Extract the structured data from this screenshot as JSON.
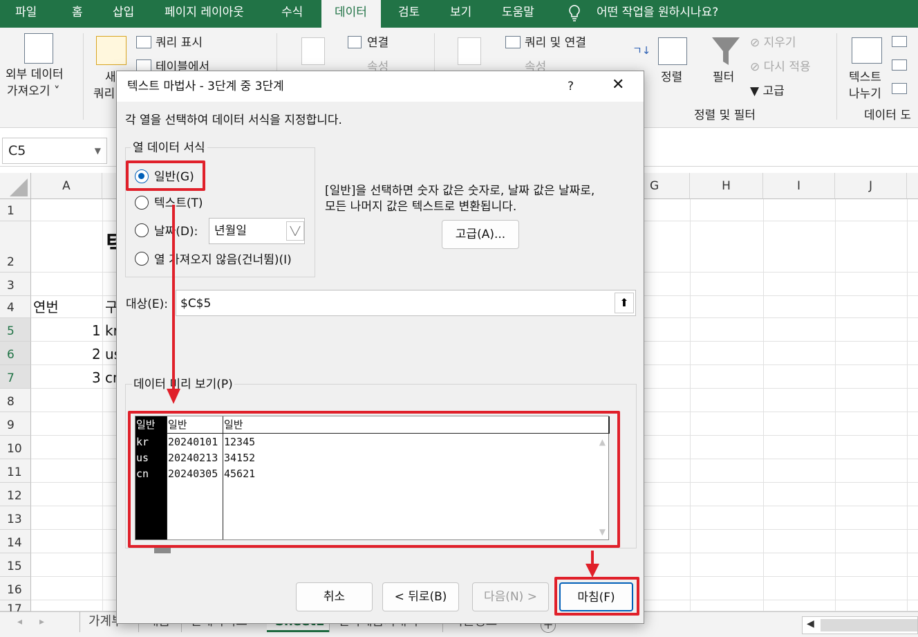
{
  "ribbon_tabs": [
    "파일",
    "홈",
    "삽입",
    "페이지 레이아웃",
    "수식",
    "데이터",
    "검토",
    "보기",
    "도움말"
  ],
  "tell_me": "어떤 작업을 원하시나요?",
  "ribbon": {
    "get_external_1": "외부 데이터",
    "get_external_2": "가져오기 ˅",
    "new_query_1": "새",
    "new_query_2": "쿼리",
    "show_queries": "쿼리 표시",
    "from_table": "테이블에서",
    "connections": "연결",
    "properties": "속성",
    "queries_connections": "쿼리 및 연결",
    "properties2": "속성",
    "sort": "정렬",
    "filter": "필터",
    "clear": "지우기",
    "reapply": "다시 적용",
    "advanced": "고급",
    "sort_filter_group": "정렬 및 필터",
    "text_to_columns_1": "텍스트",
    "text_to_columns_2": "나누기",
    "data_tools_group": "데이터 도"
  },
  "name_box": "C5",
  "columns": [
    "A",
    "G",
    "H",
    "I",
    "J"
  ],
  "rows": [
    "1",
    "2",
    "3",
    "4",
    "5",
    "6",
    "7",
    "8",
    "9",
    "10",
    "11",
    "12",
    "13",
    "14",
    "15",
    "16",
    "17"
  ],
  "cells": {
    "a4": "연번",
    "b4": "구",
    "a5": "1",
    "b5": "kr",
    "a6": "2",
    "b6": "us",
    "a7": "3",
    "b7": "cn",
    "b2": "텍"
  },
  "sheet_tabs": [
    "가계부",
    "재금",
    "전세자이즈",
    "Sheet1",
    "전자세금기대서",
    "직원정보"
  ],
  "dialog": {
    "title": "텍스트 마법사 - 3단계 중 3단계",
    "help": "?",
    "close": "✕",
    "instruction": "각 열을 선택하여 데이터 서식을 지정합니다.",
    "group_label": "열 데이터 서식",
    "opt_general": "일반(G)",
    "opt_text": "텍스트(T)",
    "opt_date": "날짜(D):",
    "date_value": "년월일",
    "opt_skip": "열 가져오지 않음(건너뜀)(I)",
    "desc_line1": "[일반]을 선택하면 숫자 값은 숫자로, 날짜 값은 날짜로,",
    "desc_line2": "모든 나머지 값은 텍스트로 변환됩니다.",
    "advanced_btn": "고급(A)...",
    "dest_label": "대상(E):",
    "dest_value": "$C$5",
    "preview_label": "데이터 미리 보기(P)",
    "preview_headers": [
      "일반",
      "일반",
      "일반"
    ],
    "preview_rows": [
      [
        "kr",
        "20240101",
        "12345"
      ],
      [
        "us",
        "20240213",
        "34152"
      ],
      [
        "cn",
        "20240305",
        "45621"
      ]
    ],
    "cancel_btn": "취소",
    "back_btn": "< 뒤로(B)",
    "next_btn": "다음(N) >",
    "finish_btn": "마침(F)"
  },
  "colors": {
    "excel_green": "#217346",
    "highlight_red": "#e0202a",
    "radio_blue": "#005fb8"
  }
}
